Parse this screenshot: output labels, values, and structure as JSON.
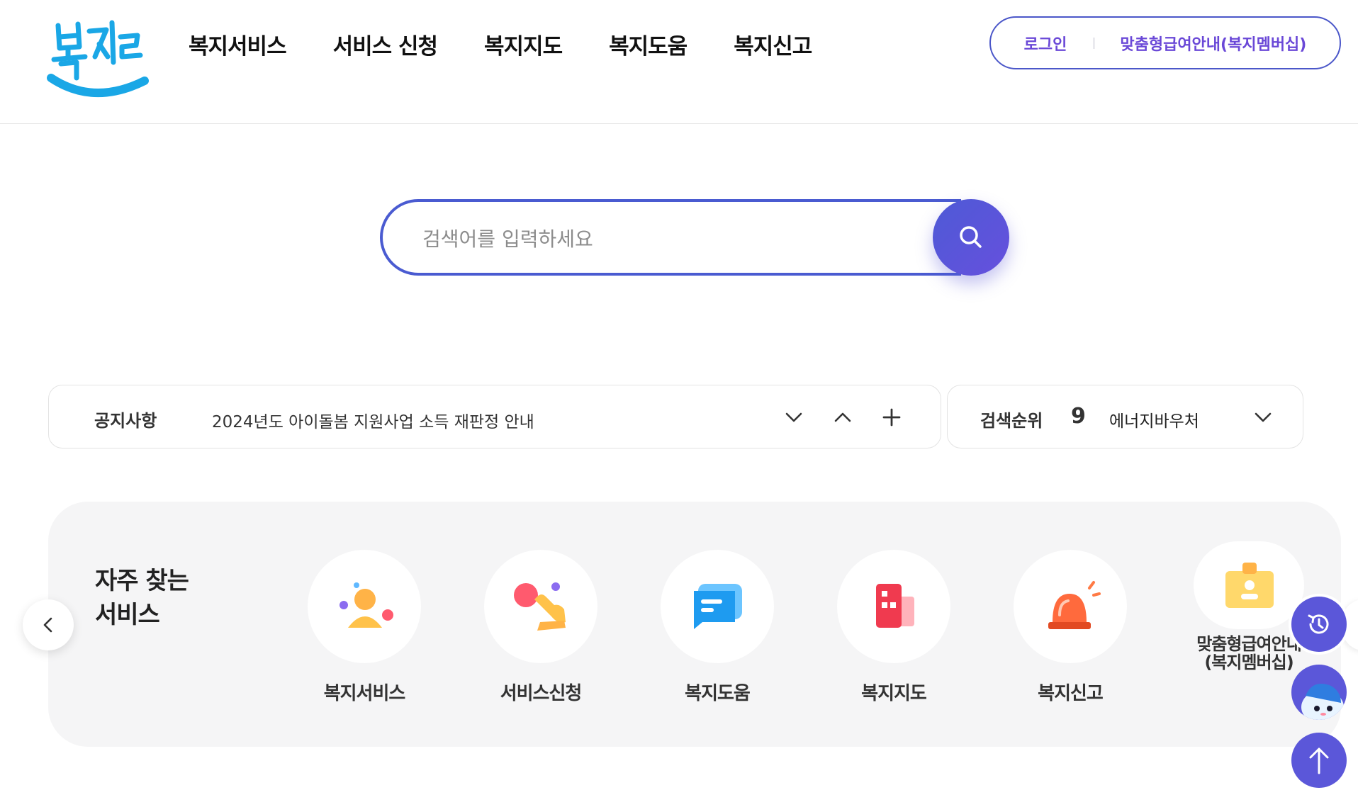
{
  "header": {
    "logo_text": "복지로",
    "nav": [
      "복지서비스",
      "서비스 신청",
      "복지지도",
      "복지도움",
      "복지신고"
    ],
    "login_label": "로그인",
    "membership_label": "맞춤형급여안내(복지멤버십)"
  },
  "search": {
    "placeholder": "검색어를 입력하세요",
    "button_icon": "search-icon"
  },
  "notice": {
    "label": "공지사항",
    "text": "2024년도 아이돌봄 지원사업 소득 재판정 안내",
    "controls": [
      "chevron-down-icon",
      "chevron-up-icon",
      "plus-icon"
    ]
  },
  "ranking": {
    "label": "검색순위",
    "rank": "9",
    "keyword": "에너지바우처"
  },
  "frequent": {
    "title_line1": "자주 찾는",
    "title_line2": "서비스",
    "items": [
      {
        "label": "복지서비스",
        "icon": "people-icon"
      },
      {
        "label": "서비스신청",
        "icon": "tap-hand-icon"
      },
      {
        "label": "복지도움",
        "icon": "chat-bubble-icon"
      },
      {
        "label": "복지지도",
        "icon": "map-building-icon"
      },
      {
        "label": "복지신고",
        "icon": "siren-icon"
      },
      {
        "label_line1": "맞춤형급여안내",
        "label_line2": "(복지멤버십)",
        "icon": "id-card-icon"
      }
    ]
  },
  "floating": [
    "history-icon",
    "chatbot-icon",
    "arrow-up-icon"
  ],
  "colors": {
    "primary": "#4a5bd1",
    "accent_purple": "#6a48d7",
    "logo_blue": "#1aa7e6",
    "panel_bg": "#f5f5f6"
  }
}
